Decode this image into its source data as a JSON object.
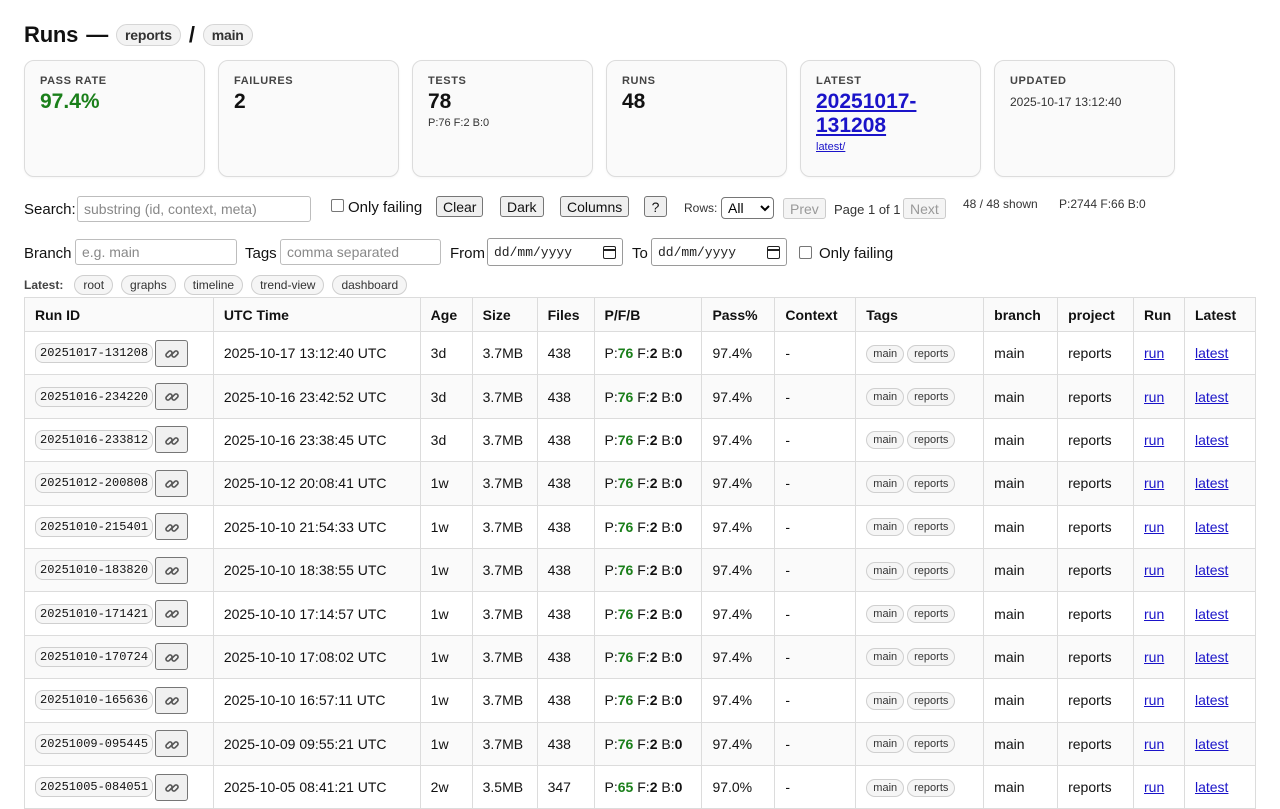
{
  "title": {
    "text": "Runs",
    "dash": "—",
    "project_pill": "reports",
    "slash": "/",
    "branch_pill": "main"
  },
  "cards": {
    "pass_rate": {
      "label": "PASS RATE",
      "value": "97.4%"
    },
    "failures": {
      "label": "FAILURES",
      "value": "2"
    },
    "tests": {
      "label": "TESTS",
      "value": "78",
      "sub": "P:76 F:2 B:0"
    },
    "runs": {
      "label": "RUNS",
      "value": "48"
    },
    "latest": {
      "label": "LATEST",
      "value": "20251017-131208",
      "sub": "latest/"
    },
    "updated": {
      "label": "UPDATED",
      "value": "2025-10-17 13:12:40"
    }
  },
  "toolbar": {
    "search_label": "Search:",
    "search_placeholder": "substring (id, context, meta)",
    "only_failing": "Only failing",
    "clear": "Clear",
    "dark": "Dark",
    "columns": "Columns",
    "help": "?",
    "rows_label": "Rows:",
    "rows_value": "All",
    "prev": "Prev",
    "page": "Page 1 of 1",
    "next": "Next",
    "shown": "48 / 48 shown",
    "totals": "P:2744 F:66 B:0"
  },
  "filters": {
    "branch_label": "Branch",
    "branch_placeholder": "e.g. main",
    "tags_label": "Tags",
    "tags_placeholder": "comma separated",
    "from_label": "From",
    "from_value": "dd/mm/yyyy",
    "to_label": "To",
    "to_value": "dd/mm/yyyy",
    "only_failing": "Only failing"
  },
  "latest_links": {
    "label": "Latest:",
    "items": [
      "root",
      "graphs",
      "timeline",
      "trend-view",
      "dashboard"
    ]
  },
  "table": {
    "headers": [
      "Run ID",
      "UTC Time",
      "Age",
      "Size",
      "Files",
      "P/F/B",
      "Pass%",
      "Context",
      "Tags",
      "branch",
      "project",
      "Run",
      "Latest"
    ],
    "rows": [
      {
        "id": "20251017-131208",
        "time": "2025-10-17 13:12:40 UTC",
        "age": "3d",
        "size": "3.7MB",
        "files": "438",
        "p": "76",
        "f": "2",
        "b": "0",
        "pass": "97.4%",
        "context": "-",
        "tags": [
          "main",
          "reports"
        ],
        "branch": "main",
        "project": "reports",
        "run": "run",
        "latest": "latest"
      },
      {
        "id": "20251016-234220",
        "time": "2025-10-16 23:42:52 UTC",
        "age": "3d",
        "size": "3.7MB",
        "files": "438",
        "p": "76",
        "f": "2",
        "b": "0",
        "pass": "97.4%",
        "context": "-",
        "tags": [
          "main",
          "reports"
        ],
        "branch": "main",
        "project": "reports",
        "run": "run",
        "latest": "latest"
      },
      {
        "id": "20251016-233812",
        "time": "2025-10-16 23:38:45 UTC",
        "age": "3d",
        "size": "3.7MB",
        "files": "438",
        "p": "76",
        "f": "2",
        "b": "0",
        "pass": "97.4%",
        "context": "-",
        "tags": [
          "main",
          "reports"
        ],
        "branch": "main",
        "project": "reports",
        "run": "run",
        "latest": "latest"
      },
      {
        "id": "20251012-200808",
        "time": "2025-10-12 20:08:41 UTC",
        "age": "1w",
        "size": "3.7MB",
        "files": "438",
        "p": "76",
        "f": "2",
        "b": "0",
        "pass": "97.4%",
        "context": "-",
        "tags": [
          "main",
          "reports"
        ],
        "branch": "main",
        "project": "reports",
        "run": "run",
        "latest": "latest"
      },
      {
        "id": "20251010-215401",
        "time": "2025-10-10 21:54:33 UTC",
        "age": "1w",
        "size": "3.7MB",
        "files": "438",
        "p": "76",
        "f": "2",
        "b": "0",
        "pass": "97.4%",
        "context": "-",
        "tags": [
          "main",
          "reports"
        ],
        "branch": "main",
        "project": "reports",
        "run": "run",
        "latest": "latest"
      },
      {
        "id": "20251010-183820",
        "time": "2025-10-10 18:38:55 UTC",
        "age": "1w",
        "size": "3.7MB",
        "files": "438",
        "p": "76",
        "f": "2",
        "b": "0",
        "pass": "97.4%",
        "context": "-",
        "tags": [
          "main",
          "reports"
        ],
        "branch": "main",
        "project": "reports",
        "run": "run",
        "latest": "latest"
      },
      {
        "id": "20251010-171421",
        "time": "2025-10-10 17:14:57 UTC",
        "age": "1w",
        "size": "3.7MB",
        "files": "438",
        "p": "76",
        "f": "2",
        "b": "0",
        "pass": "97.4%",
        "context": "-",
        "tags": [
          "main",
          "reports"
        ],
        "branch": "main",
        "project": "reports",
        "run": "run",
        "latest": "latest"
      },
      {
        "id": "20251010-170724",
        "time": "2025-10-10 17:08:02 UTC",
        "age": "1w",
        "size": "3.7MB",
        "files": "438",
        "p": "76",
        "f": "2",
        "b": "0",
        "pass": "97.4%",
        "context": "-",
        "tags": [
          "main",
          "reports"
        ],
        "branch": "main",
        "project": "reports",
        "run": "run",
        "latest": "latest"
      },
      {
        "id": "20251010-165636",
        "time": "2025-10-10 16:57:11 UTC",
        "age": "1w",
        "size": "3.7MB",
        "files": "438",
        "p": "76",
        "f": "2",
        "b": "0",
        "pass": "97.4%",
        "context": "-",
        "tags": [
          "main",
          "reports"
        ],
        "branch": "main",
        "project": "reports",
        "run": "run",
        "latest": "latest"
      },
      {
        "id": "20251009-095445",
        "time": "2025-10-09 09:55:21 UTC",
        "age": "1w",
        "size": "3.7MB",
        "files": "438",
        "p": "76",
        "f": "2",
        "b": "0",
        "pass": "97.4%",
        "context": "-",
        "tags": [
          "main",
          "reports"
        ],
        "branch": "main",
        "project": "reports",
        "run": "run",
        "latest": "latest"
      },
      {
        "id": "20251005-084051",
        "time": "2025-10-05 08:41:21 UTC",
        "age": "2w",
        "size": "3.5MB",
        "files": "347",
        "p": "65",
        "f": "2",
        "b": "0",
        "pass": "97.0%",
        "context": "-",
        "tags": [
          "main",
          "reports"
        ],
        "branch": "main",
        "project": "reports",
        "run": "run",
        "latest": "latest"
      }
    ]
  },
  "icons": {
    "link_button": "link-icon",
    "date_picker": "calendar-icon"
  },
  "colors": {
    "pass_green": "#1a7f1a",
    "link_blue": "#1a13c9"
  }
}
